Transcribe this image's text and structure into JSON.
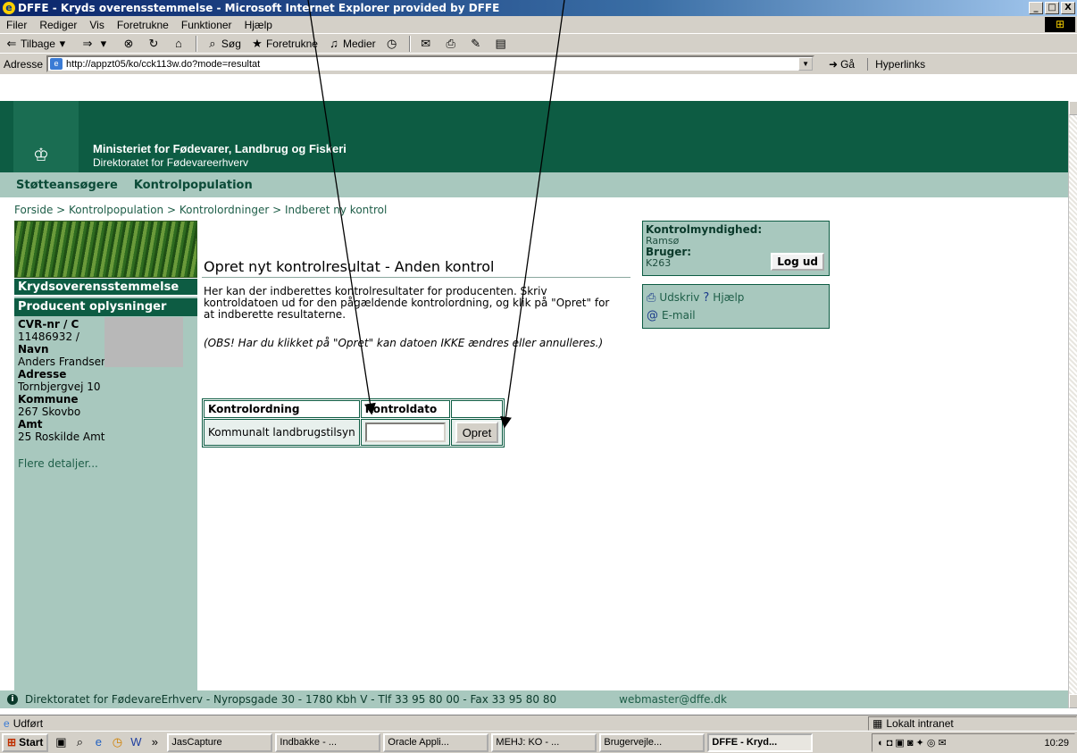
{
  "window": {
    "title": "DFFE - Kryds overensstemmelse - Microsoft Internet Explorer provided by DFFE",
    "min": "_",
    "max": "□",
    "close": "X"
  },
  "menu": [
    "Filer",
    "Rediger",
    "Vis",
    "Foretrukne",
    "Funktioner",
    "Hjælp"
  ],
  "toolbar": {
    "back": "Tilbage",
    "search": "Søg",
    "favorites": "Foretrukne",
    "media": "Medier"
  },
  "address": {
    "label": "Adresse",
    "url": "http://appzt05/ko/cck113w.do?mode=resultat",
    "go": "Gå",
    "links": "Hyperlinks"
  },
  "banner": {
    "ministry": "Ministeriet for Fødevarer, Landbrug og Fiskeri",
    "directorate": "Direktoratet for Fødevareerhverv"
  },
  "nav": [
    "Støtteansøgere",
    "Kontrolpopulation"
  ],
  "breadcrumb": "Forside > Kontrolpopulation > Kontrolordninger > Indberet ny kontrol",
  "sidebar": {
    "section1": "Krydsoverensstemmelse",
    "section2": "Producent oplysninger",
    "cvr_label": "CVR-nr / C",
    "cvr_value": "11486932 /",
    "name_label": "Navn",
    "name_value": "Anders Frandsen",
    "address_label": "Adresse",
    "address_value": "Tornbjergvej 10",
    "kommune_label": "Kommune",
    "kommune_value": "267 Skovbo",
    "amt_label": "Amt",
    "amt_value": "25 Roskilde Amt",
    "more": "Flere detaljer..."
  },
  "main": {
    "title": "Opret nyt kontrolresultat - Anden kontrol",
    "description": "Her kan der indberettes kontrolresultater for producenten. Skriv kontroldatoen ud for den pågældende kontrolordning, og klik på \"Opret\" for at indberette resultaterne.",
    "note": "(OBS! Har du klikket på \"Opret\" kan datoen IKKE ændres eller annulleres.)",
    "table": {
      "headers": [
        "Kontrolordning",
        "Kontroldato",
        ""
      ],
      "row": {
        "ordning": "Kommunalt landbrugstilsyn",
        "date_value": "",
        "button": "Opret"
      }
    }
  },
  "info": {
    "authority_label": "Kontrolmyndighed:",
    "authority_value": "Ramsø",
    "user_label": "Bruger:",
    "user_value": "K263",
    "logout": "Log ud"
  },
  "tools": {
    "print": "Udskriv",
    "help": "Hjælp",
    "email": "E-mail"
  },
  "footer": {
    "address": "Direktoratet for FødevareErhverv - Nyropsgade 30 - 1780 Kbh V - Tlf 33 95 80 00 - Fax 33 95 80 80",
    "email": "webmaster@dffe.dk"
  },
  "status": {
    "text": "Udført",
    "zone": "Lokalt intranet"
  },
  "taskbar": {
    "start": "Start",
    "chevron": "»",
    "tasks": [
      "JasCapture",
      "Indbakke - ...",
      "Oracle Appli...",
      "MEHJ: KO - ...",
      "Brugervejle...",
      "DFFE - Kryd..."
    ],
    "clock": "10:29"
  }
}
